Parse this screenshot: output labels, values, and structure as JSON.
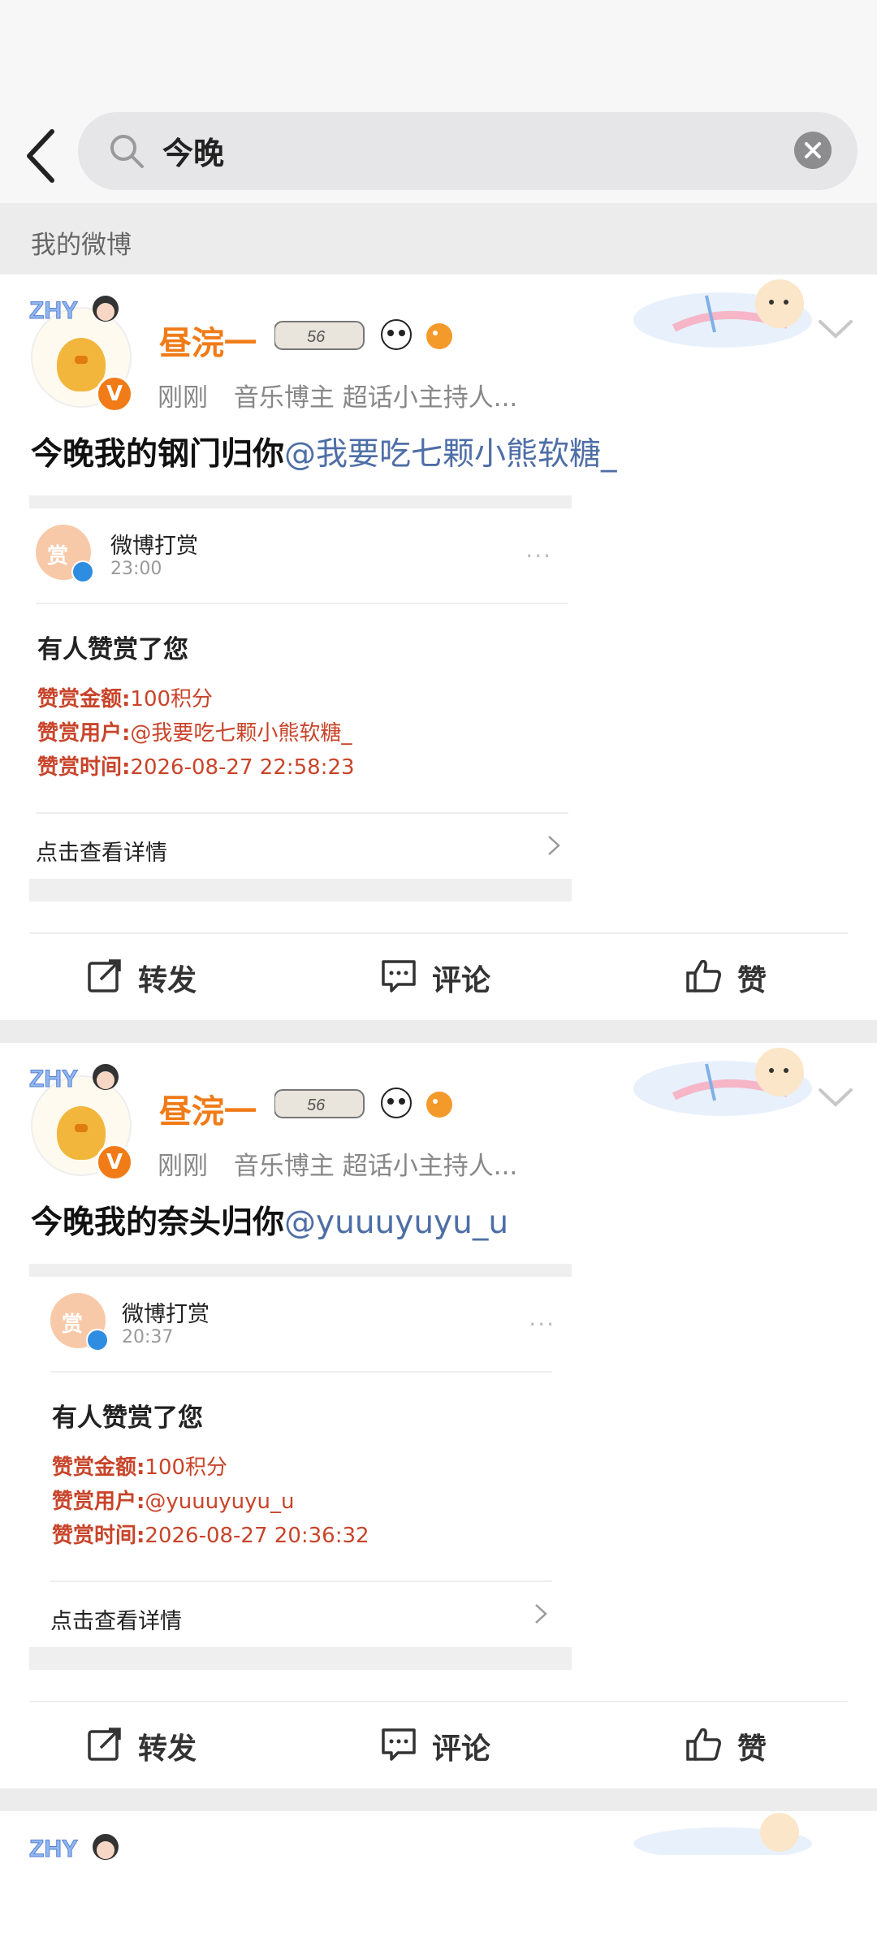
{
  "search": {
    "query": "今晚"
  },
  "section_title": "我的微博",
  "posts": [
    {
      "author": "昼浣一",
      "time": "刚刚",
      "tags": "音乐博主 超话小主持人...",
      "text": "今晚我的钢门归你",
      "mention": "@我要吃七颗小熊软糖_",
      "card": {
        "sender": "微博打赏",
        "sender_time": "23:00",
        "title": "有人赞赏了您",
        "amount_label": "赞赏金额:",
        "amount": "100积分",
        "user_label": "赞赏用户:",
        "user": "@我要吃七颗小熊软糖_",
        "time_label": "赞赏时间:",
        "time": "2026-08-27 22:58:23",
        "link": "点击查看详情"
      }
    },
    {
      "author": "昼浣一",
      "time": "刚刚",
      "tags": "音乐博主 超话小主持人...",
      "text": "今晚我的奈头归你",
      "mention": "@yuuuyuyu_u",
      "card": {
        "sender": "微博打赏",
        "sender_time": "20:37",
        "title": "有人赞赏了您",
        "amount_label": "赞赏金额:",
        "amount": "100积分",
        "user_label": "赞赏用户:",
        "user": "@yuuuyuyu_u",
        "time_label": "赞赏时间:",
        "time": "2026-08-27 20:36:32",
        "link": "点击查看详情"
      }
    }
  ],
  "actions": {
    "share": "转发",
    "comment": "评论",
    "like": "赞"
  },
  "colors": {
    "accent": "#f07b17",
    "mention": "#4e6ea6",
    "reward_red": "#c8442a"
  }
}
